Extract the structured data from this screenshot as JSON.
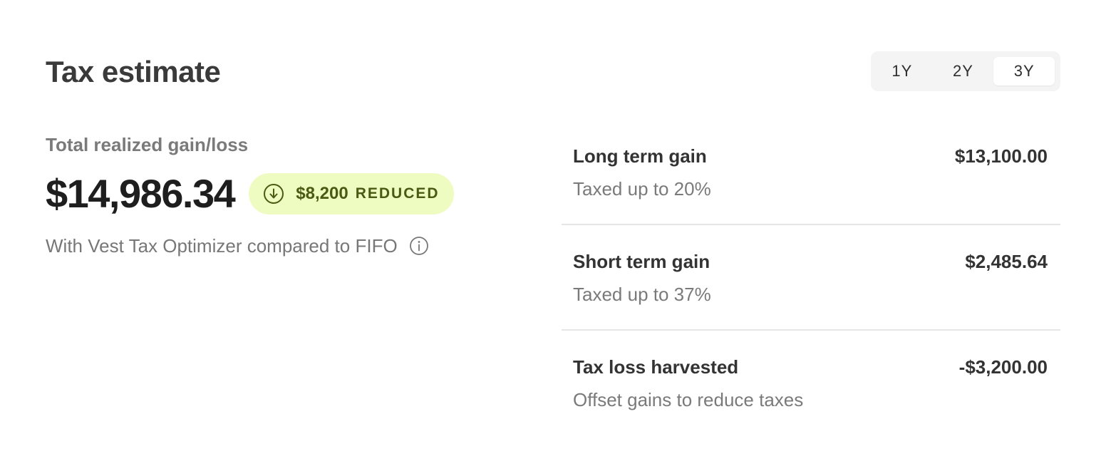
{
  "header": {
    "title": "Tax estimate"
  },
  "period_selector": {
    "options": [
      "1Y",
      "2Y",
      "3Y"
    ],
    "selected": "3Y"
  },
  "summary": {
    "label": "Total realized gain/loss",
    "amount": "$14,986.34",
    "badge": {
      "amount": "$8,200",
      "word": "REDUCED",
      "icon": "arrow-down-circle-icon",
      "background": "#eefcc2",
      "text_color": "#4a5a12"
    },
    "note": "With Vest Tax Optimizer compared to FIFO",
    "note_icon": "info-icon"
  },
  "breakdown": [
    {
      "label": "Long term gain",
      "description": "Taxed up to 20%",
      "value": "$13,100.00"
    },
    {
      "label": "Short term gain",
      "description": "Taxed up to 37%",
      "value": "$2,485.64"
    },
    {
      "label": "Tax loss harvested",
      "description": "Offset gains to reduce taxes",
      "value": "-$3,200.00"
    }
  ]
}
